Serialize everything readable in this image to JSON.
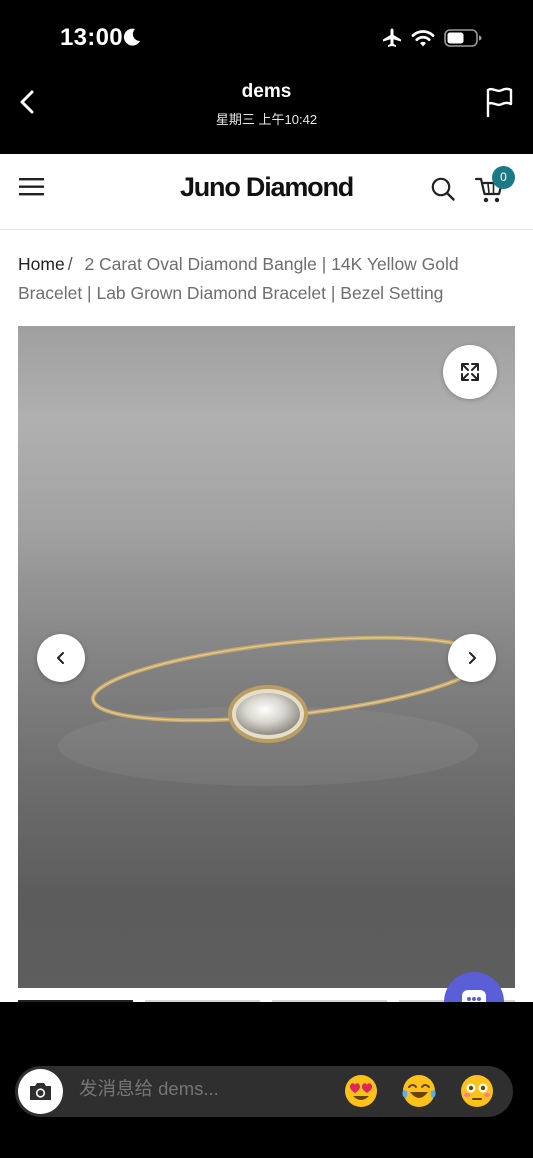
{
  "status_bar": {
    "time": "13:00",
    "icons": [
      "moon-icon",
      "airplane-icon",
      "wifi-icon",
      "battery-icon"
    ]
  },
  "chat_header": {
    "name": "dems",
    "subtitle": "星期三 上午10:42",
    "icons": [
      "back-icon",
      "flag-icon"
    ]
  },
  "site": {
    "logo": "Juno Diamond",
    "cart_count": "0",
    "accent_color": "#1b7a86",
    "icons": [
      "menu-icon",
      "search-icon",
      "cart-icon",
      "expand-icon",
      "chevron-left-icon",
      "chevron-right-icon",
      "chat-icon"
    ]
  },
  "breadcrumb": {
    "home": "Home",
    "separator": "/",
    "current": "2 Carat Oval Diamond Bangle | 14K Yellow Gold Bracelet | Lab Grown Diamond Bracelet | Bezel Setting"
  },
  "message_bar": {
    "placeholder": "发消息给 dems...",
    "emojis": [
      "heart-eyes-emoji",
      "laughing-emoji",
      "flushed-emoji"
    ]
  }
}
